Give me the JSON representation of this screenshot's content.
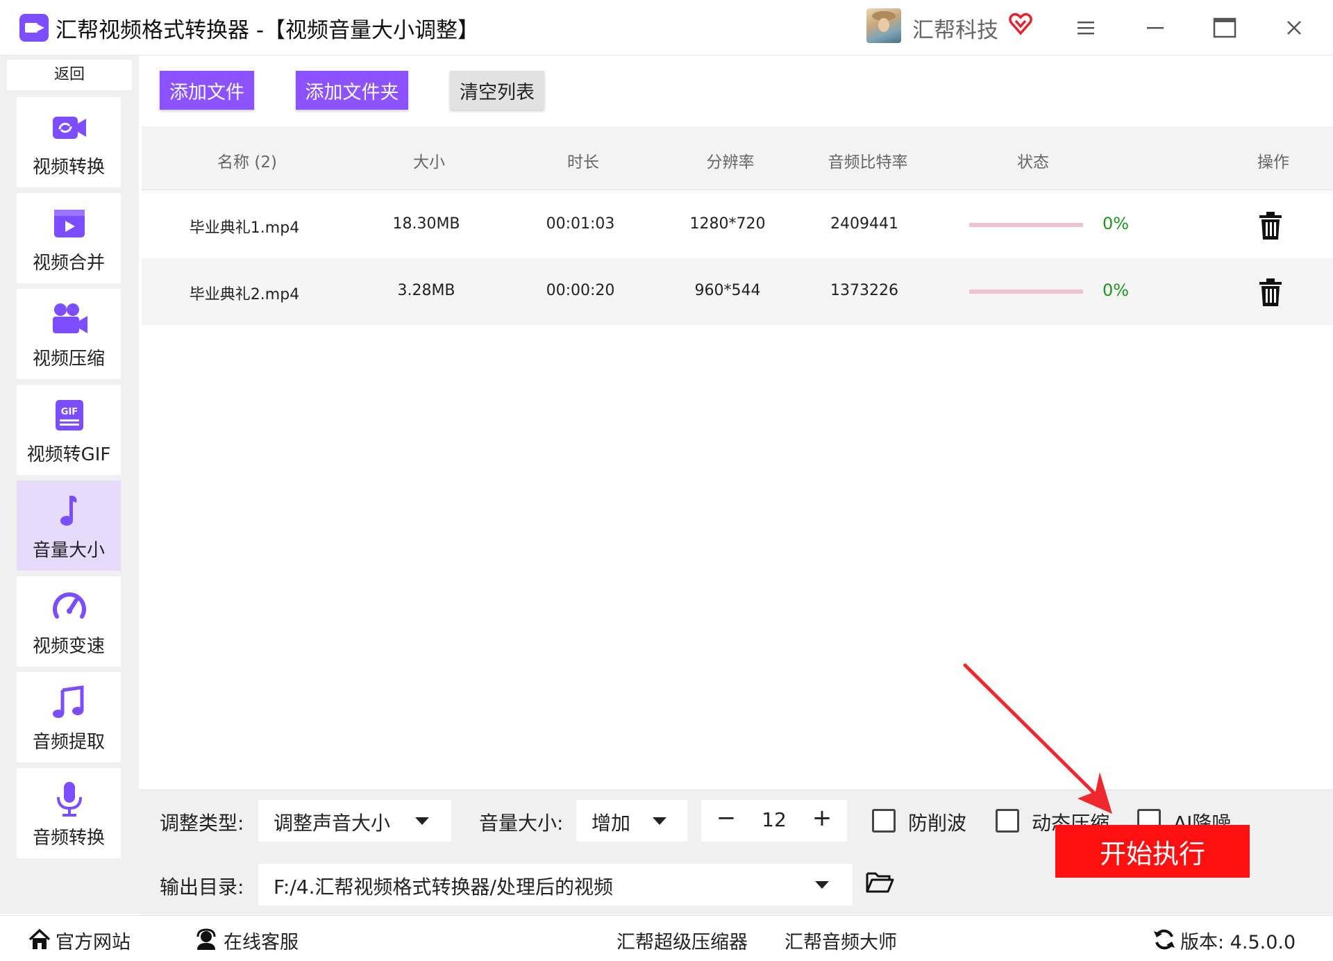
{
  "window": {
    "title": "汇帮视频格式转换器   -【视频音量大小调整】",
    "user_name": "汇帮科技",
    "icons": [
      "app-logo-icon",
      "vip-heart-icon",
      "menu-icon",
      "minimize-icon",
      "maximize-icon",
      "close-icon"
    ]
  },
  "sidebar": {
    "back_label": "返回",
    "items": [
      {
        "label": "视频转换",
        "icon": "video-convert-icon",
        "active": false
      },
      {
        "label": "视频合并",
        "icon": "video-merge-icon",
        "active": false
      },
      {
        "label": "视频压缩",
        "icon": "video-compress-icon",
        "active": false
      },
      {
        "label": "视频转GIF",
        "icon": "gif-icon",
        "active": false
      },
      {
        "label": "音量大小",
        "icon": "music-note-icon",
        "active": true
      },
      {
        "label": "视频变速",
        "icon": "speedometer-icon",
        "active": false
      },
      {
        "label": "音频提取",
        "icon": "audio-extract-icon",
        "active": false
      },
      {
        "label": "音频转换",
        "icon": "microphone-icon",
        "active": false
      }
    ]
  },
  "toolbar": {
    "add_file": "添加文件",
    "add_folder": "添加文件夹",
    "clear_list": "清空列表"
  },
  "table": {
    "headers": {
      "name": "名称 (2)",
      "size": "大小",
      "duration": "时长",
      "resolution": "分辨率",
      "bitrate": "音频比特率",
      "status": "状态",
      "action": "操作"
    },
    "rows": [
      {
        "name": "毕业典礼1.mp4",
        "size": "18.30MB",
        "duration": "00:01:03",
        "resolution": "1280*720",
        "bitrate": "2409441",
        "progress": 0,
        "progress_text": "0%"
      },
      {
        "name": "毕业典礼2.mp4",
        "size": "3.28MB",
        "duration": "00:00:20",
        "resolution": "960*544",
        "bitrate": "1373226",
        "progress": 0,
        "progress_text": "0%"
      }
    ]
  },
  "settings": {
    "adjust_type_label": "调整类型:",
    "adjust_type_value": "调整声音大小",
    "volume_label": "音量大小:",
    "volume_mode": "增加",
    "volume_minus": "−",
    "volume_value": "12",
    "volume_plus": "+",
    "anti_clip_label": "防削波",
    "anti_clip_checked": false,
    "dynamic_compress_label": "动态压缩",
    "dynamic_compress_checked": false,
    "ai_denoise_label": "AI降噪",
    "ai_denoise_checked": false,
    "output_label": "输出目录:",
    "output_path": "F:/4.汇帮视频格式转换器/处理后的视频",
    "start_button": "开始执行"
  },
  "statusbar": {
    "website": "官方网站",
    "support": "在线客服",
    "compressor": "汇帮超级压缩器",
    "audio_master": "汇帮音频大师",
    "version": "版本: 4.5.0.0"
  },
  "colors": {
    "accent": "#8c52ff",
    "active_nav": "#e6dbfb",
    "start_button": "#ff1010",
    "progress_track": "#f2c2cf",
    "percent_text": "#1a9a1a",
    "annotation_arrow": "#f0282d"
  }
}
